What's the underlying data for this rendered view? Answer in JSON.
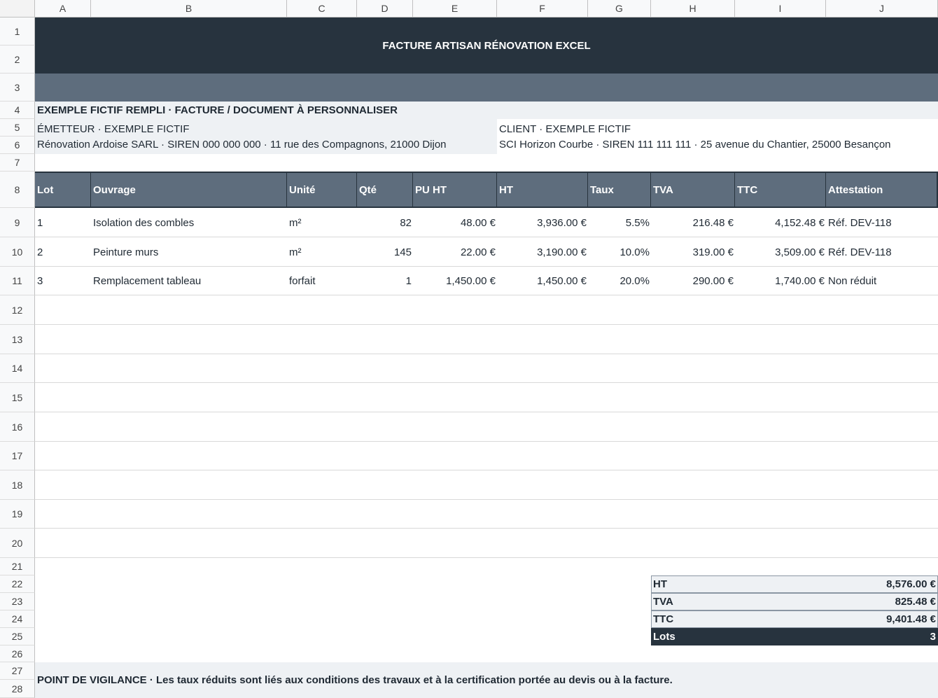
{
  "columns": [
    "A",
    "B",
    "C",
    "D",
    "E",
    "F",
    "G",
    "H",
    "I",
    "J"
  ],
  "rows": [
    "1",
    "2",
    "3",
    "4",
    "5",
    "6",
    "7",
    "8",
    "9",
    "10",
    "11",
    "12",
    "13",
    "14",
    "15",
    "16",
    "17",
    "18",
    "19",
    "20",
    "21",
    "22",
    "23",
    "24",
    "25",
    "26",
    "27",
    "28"
  ],
  "title": "FACTURE ARTISAN RÉNOVATION EXCEL",
  "subtitle": "EXEMPLE FICTIF REMPLI · FACTURE / DOCUMENT À PERSONNALISER",
  "emitter": {
    "label": "ÉMETTEUR · EXEMPLE FICTIF",
    "details": "Rénovation Ardoise SARL · SIREN 000 000 000 · 11 rue des Compagnons, 21000 Dijon"
  },
  "client": {
    "label": "CLIENT · EXEMPLE FICTIF",
    "details": "SCI Horizon Courbe · SIREN 111 111 111 · 25 avenue du Chantier, 25000 Besançon"
  },
  "table": {
    "headers": [
      "Lot",
      "Ouvrage",
      "Unité",
      "Qté",
      "PU HT",
      "HT",
      "Taux",
      "TVA",
      "TTC",
      "Attestation"
    ],
    "rows": [
      [
        "1",
        "Isolation des combles",
        "m²",
        "82",
        "48.00 €",
        "3,936.00 €",
        "5.5%",
        "216.48 €",
        "4,152.48 €",
        "Réf. DEV-118"
      ],
      [
        "2",
        "Peinture murs",
        "m²",
        "145",
        "22.00 €",
        "3,190.00 €",
        "10.0%",
        "319.00 €",
        "3,509.00 €",
        "Réf. DEV-118"
      ],
      [
        "3",
        "Remplacement tableau",
        "forfait",
        "1",
        "1,450.00 €",
        "1,450.00 €",
        "20.0%",
        "290.00 €",
        "1,740.00 €",
        "Non réduit"
      ]
    ]
  },
  "totals": [
    {
      "label": "HT",
      "value": "8,576.00 €"
    },
    {
      "label": "TVA",
      "value": "825.48 €"
    },
    {
      "label": "TTC",
      "value": "9,401.48 €"
    },
    {
      "label": "Lots",
      "value": "3"
    }
  ],
  "note": "POINT DE VIGILANCE · Les taux réduits sont liés aux conditions des travaux et à la certification portée au devis ou à la facture.",
  "colors": {
    "dark": "#27333e",
    "header": "#5e6d7d",
    "light": "#eef1f4"
  }
}
